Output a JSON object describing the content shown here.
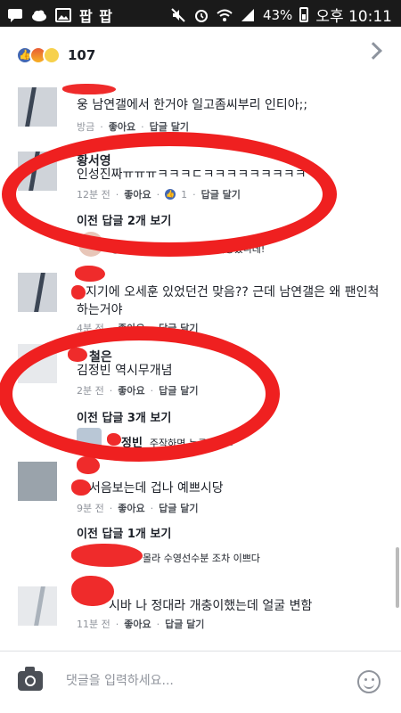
{
  "status_bar": {
    "app_label": "팝 팝",
    "battery": "43%",
    "time": "오후 10:11"
  },
  "reactions": {
    "count": "107"
  },
  "comments": [
    {
      "text": "웅 남연갤에서 한거야 일고좀씨부리 인티아;;",
      "meta_time": "방금",
      "like": "좋아요",
      "reply": "답글 달기"
    },
    {
      "name": "황서영",
      "text": "인성진짜ㅠㅠㅠㅋㅋㅋㄷㅋㅋㅋㅋㅋㅋㅋㅋㅋㅋ",
      "meta_time": "12분 전",
      "like": "좋아요",
      "like_count": "1",
      "reply": "답글 달기",
      "prev_replies": "이전 답글 2개 보기",
      "reply_preview": {
        "name": "황서영",
        "text": "알아요ㅠㅠㅠㅠ 죄송했니데!"
      }
    },
    {
      "text_line1": "지기에 오세훈 있었던건 맞음?? 근데 남연갤은 왜 팬인척",
      "text_line2": "하는거야",
      "meta_time": "4분 전",
      "like": "좋아요",
      "reply": "답글 달기"
    },
    {
      "name_suffix": "철은",
      "text": "김정빈 역시무개념",
      "meta_time": "2분 전",
      "like": "좋아요",
      "reply": "답글 달기",
      "prev_replies": "이전 답글 3개 보기",
      "reply_preview": {
        "name_suffix": "정빈",
        "text": "주작하면 누구겠ㅅㄴ"
      }
    },
    {
      "text": "서음보는데 겁나 예쁘시당",
      "meta_time": "9분 전",
      "like": "좋아요",
      "reply": "답글 달기",
      "prev_replies": "이전 답글 1개 보기",
      "reply_preview": {
        "text": "몰라 수영선수분 조차 이쁘다"
      }
    },
    {
      "text": "시바 나 정대라 개충이했는데 얼굴 변함",
      "meta_time": "11분 전",
      "like": "좋아요",
      "reply": "답글 달기"
    }
  ],
  "composer": {
    "placeholder": "댓글을 입력하세요..."
  },
  "colors": {
    "facebook_blue": "#4267b2",
    "annotation_red": "#ef2020",
    "meta_gray": "#90949c"
  }
}
